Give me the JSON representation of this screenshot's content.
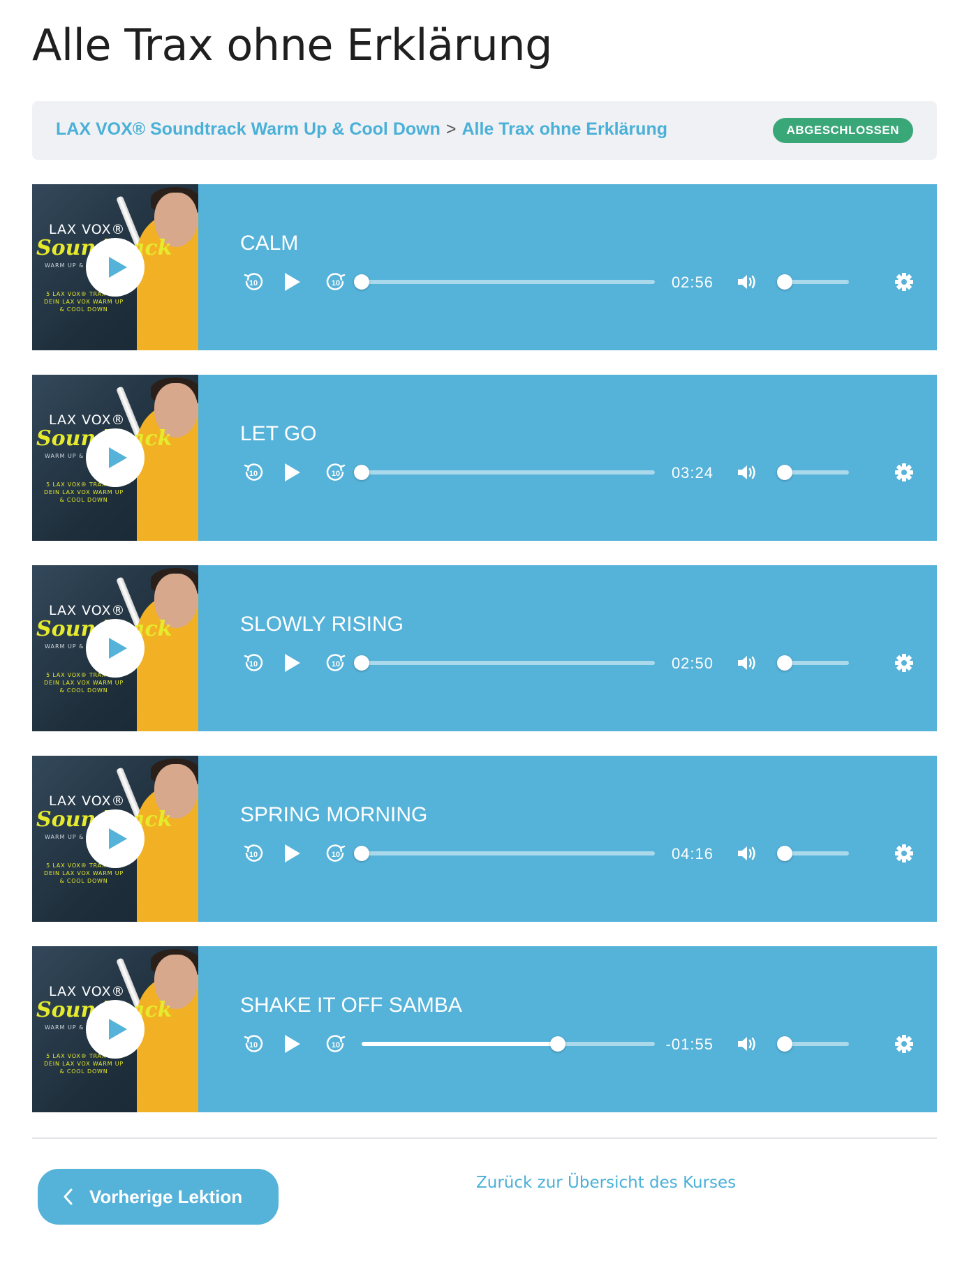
{
  "page": {
    "title": "Alle Trax ohne Erklärung"
  },
  "breadcrumb": {
    "course": "LAX VOX® Soundtrack Warm Up & Cool Down",
    "separator": ">",
    "lesson": "Alle Trax ohne Erklärung",
    "status": "ABGESCHLOSSEN"
  },
  "cover": {
    "brand": "LAX VOX®",
    "script": "Soundtrack",
    "subtitle": "WARM UP & COOL DOWN",
    "tagline": "5 LAX VOX® TRAX FÜR DEIN LAX VOX WARM UP & COOL DOWN"
  },
  "tracks": [
    {
      "title": "CALM",
      "time": "02:56",
      "progress": 0,
      "volume": 0.1
    },
    {
      "title": "LET GO",
      "time": "03:24",
      "progress": 0,
      "volume": 0.1
    },
    {
      "title": "SLOWLY RISING",
      "time": "02:50",
      "progress": 0,
      "volume": 0.1
    },
    {
      "title": "SPRING MORNING",
      "time": "04:16",
      "progress": 0,
      "volume": 0.1
    },
    {
      "title": "SHAKE IT OFF SAMBA",
      "time": "-01:55",
      "progress": 0.67,
      "volume": 0.1
    }
  ],
  "player_icons": {
    "rewind": "rewind-10-icon",
    "play": "play-icon",
    "forward": "forward-10-icon",
    "volume": "volume-icon",
    "settings": "gear-icon",
    "skip_seconds": "10"
  },
  "navigation": {
    "prev_label": "Vorherige Lektion",
    "back_label": "Zurück zur Übersicht des Kurses"
  },
  "colors": {
    "accent": "#55b2d9",
    "link": "#4ab0d8",
    "badge": "#3aa779",
    "crumb_bg": "#f0f1f4"
  }
}
